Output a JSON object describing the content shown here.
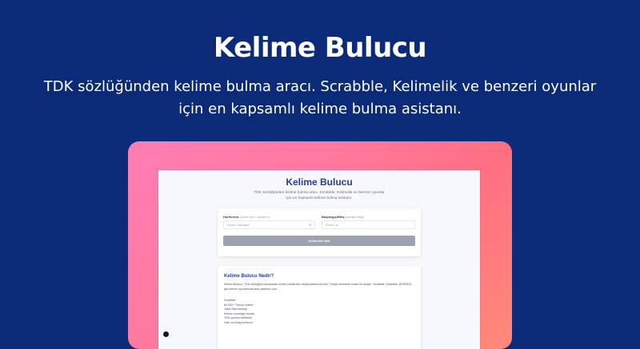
{
  "hero": {
    "title": "Kelime Bulucu",
    "subtitle_line1": "TDK sözlüğünden kelime bulma aracı. Scrabble, Kelimelik ve benzeri oyunlar",
    "subtitle_line2": "için en kapsamlı kelime bulma asistanı."
  },
  "screenshot": {
    "title": "Kelime Bulucu",
    "subtitle_line1": "TDK sözlüğünden kelime bulma aracı. Scrabble, Kelimelik ve benzeri oyunlar",
    "subtitle_line2": "için en kapsamlı kelime bulma asistanı.",
    "form": {
      "letters_label": "Harfleriniz",
      "letters_hint": "(Joker için * kullanın)",
      "letters_placeholder": "Örnek: mkoiyab*",
      "pattern_label": "Başlangıç/Bitiş",
      "pattern_hint": "(İsteğe bağlı)",
      "pattern_placeholder": "Örnek: ar",
      "submit_label": "Kelimeleri Bul"
    },
    "info": {
      "title": "Kelime Bulucu Nedir?",
      "text": "Kelime Bulucu, TDK sözlüğünü kullanarak verilen harflerden oluşturulabilecek tüm Türkçe kelimeleri bulan bir araçtır. Scrabble, Kelimelik, WORDLE gibi kelime oyunlarında size yardımcı olur.",
      "features": [
        "Özellikler",
        "80.000+ Türkçe kelime",
        "Joker harf desteği",
        "Kelime uzunluğu önerisi",
        "TDK uyumlu kelimeler",
        "Hızlı ve kolay kullanım"
      ]
    }
  }
}
